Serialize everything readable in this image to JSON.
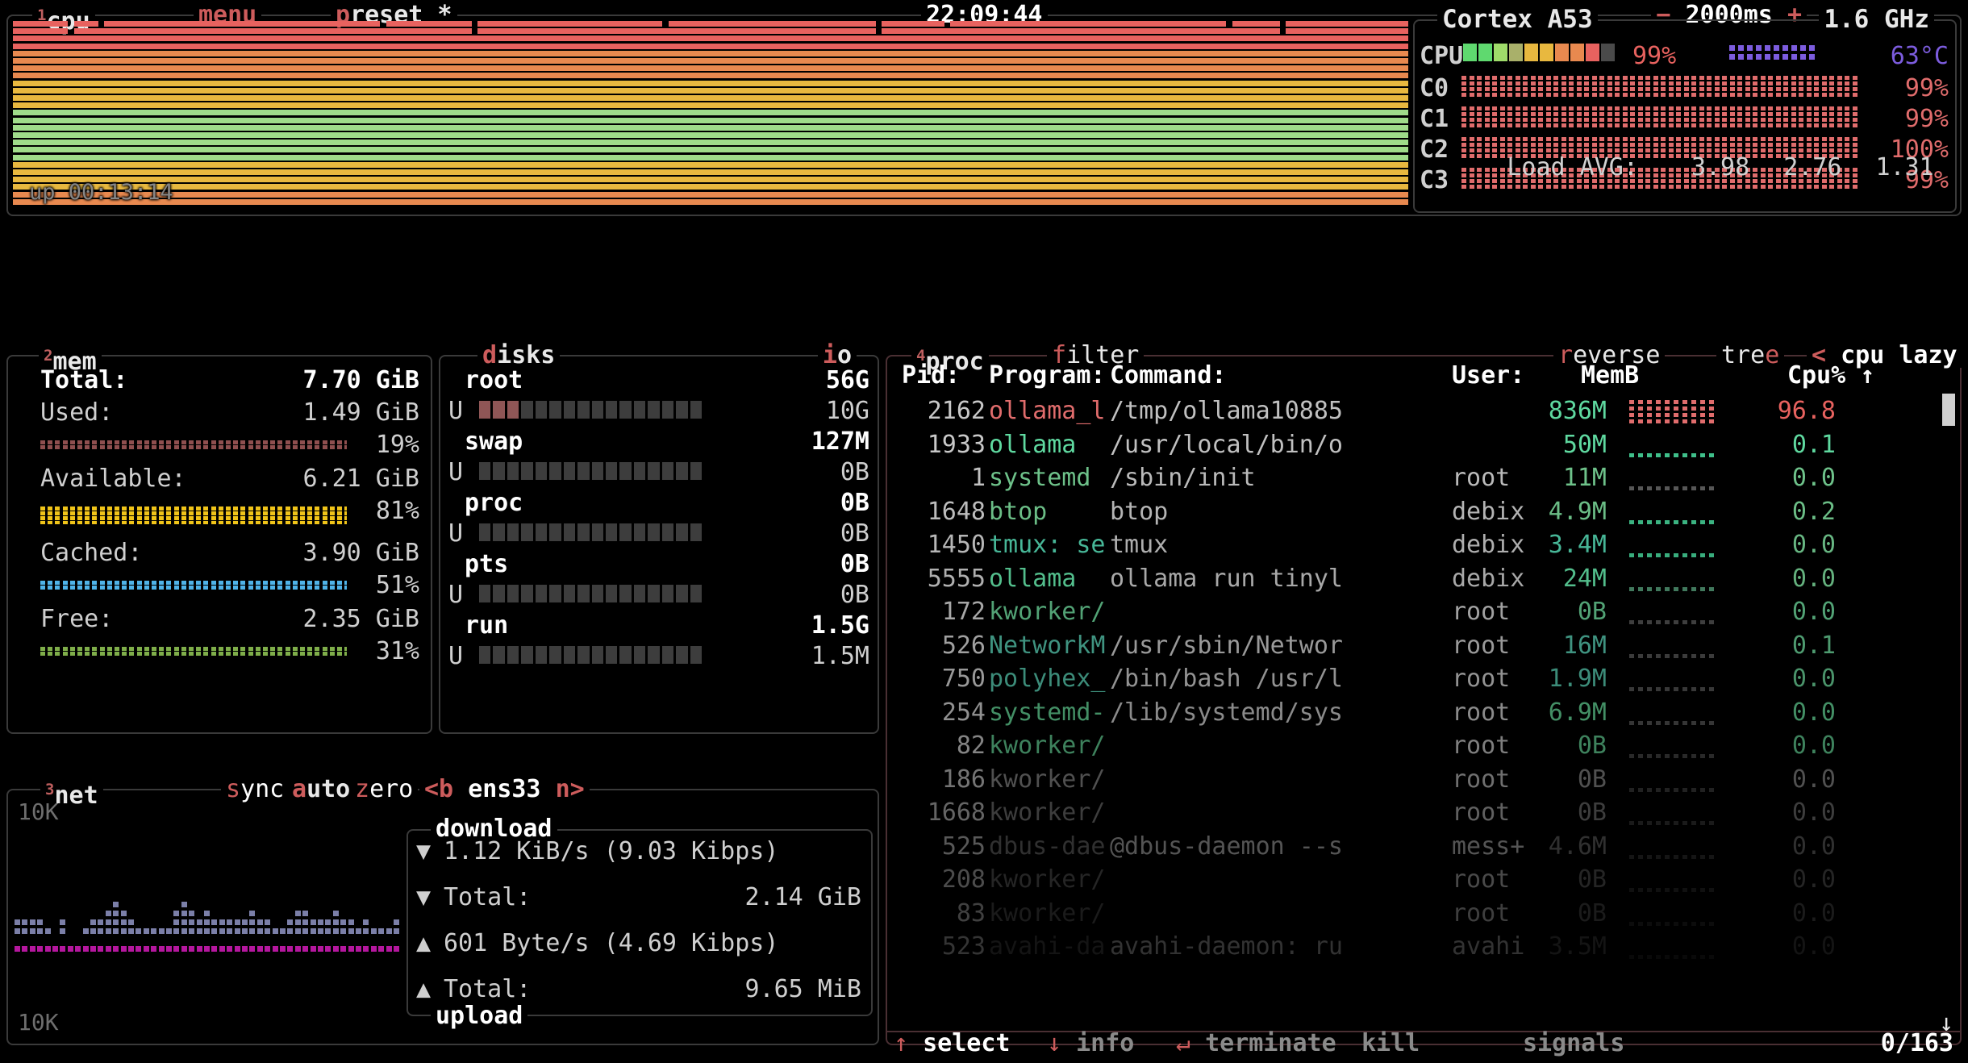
{
  "cpu": {
    "box_label": "cpu",
    "box_num": "1",
    "menu_label": "menu",
    "preset_label": "preset *",
    "clock": "22:09:44",
    "minus": "−",
    "update_ms": "2000ms",
    "plus": "+",
    "uptime": "up 00:13:14",
    "model": "Cortex A53",
    "freq": "1.6 GHz",
    "cpu_label": "CPU",
    "cpu_pct": "99%",
    "temp": "63°C",
    "cores": [
      {
        "label": "C0",
        "pct": "99%"
      },
      {
        "label": "C1",
        "pct": "99%"
      },
      {
        "label": "C2",
        "pct": "100%"
      },
      {
        "label": "C3",
        "pct": "99%"
      }
    ],
    "load_label": "Load AVG:",
    "load_1": "3.98",
    "load_5": "2.76",
    "load_15": "1.31"
  },
  "mem": {
    "box_label": "mem",
    "box_num": "2",
    "rows": [
      {
        "label": "Total:",
        "value": "7.70 GiB",
        "pct": "",
        "color": "#ffffff"
      },
      {
        "label": "Used:",
        "value": "1.49 GiB",
        "pct": "19%",
        "color": "#8f4f4f"
      },
      {
        "label": "Available:",
        "value": "6.21 GiB",
        "pct": "81%",
        "color": "#f0c419"
      },
      {
        "label": "Cached:",
        "value": "3.90 GiB",
        "pct": "51%",
        "color": "#4fb3e8"
      },
      {
        "label": "Free:",
        "value": "2.35 GiB",
        "pct": "31%",
        "color": "#7fae4a"
      }
    ]
  },
  "disks": {
    "box_label": "disks",
    "io_label": "io",
    "u_label": "U",
    "entries": [
      {
        "name": "root",
        "size": "56G",
        "used": "10G",
        "fill": 0.18
      },
      {
        "name": "swap",
        "size": "127M",
        "used": "0B",
        "fill": 0.0
      },
      {
        "name": "proc",
        "size": "0B",
        "used": "0B",
        "fill": 0.0
      },
      {
        "name": "pts",
        "size": "0B",
        "used": "0B",
        "fill": 0.0
      },
      {
        "name": "run",
        "size": "1.5G",
        "used": "1.5M",
        "fill": 0.0
      }
    ]
  },
  "net": {
    "box_label": "net",
    "box_num": "3",
    "sync_label": "sync",
    "auto_label": "auto",
    "zero_label": "zero",
    "iface_left": "<b",
    "iface": "ens33",
    "iface_right": "n>",
    "scale_top": "10K",
    "scale_bottom": "10K",
    "download_label": "download",
    "upload_label": "upload",
    "down_rate": "1.12 KiB/s (9.03 Kibps)",
    "down_total_label": "Total:",
    "down_total": "2.14 GiB",
    "up_rate": "601 Byte/s (4.69 Kibps)",
    "up_total_label": "Total:",
    "up_total": "9.65 MiB",
    "down_arrow": "▼",
    "up_arrow": "▲"
  },
  "proc": {
    "box_label": "proc",
    "box_num": "4",
    "filter_label": "filter",
    "reverse_label": "reverse",
    "tree_label": "tree",
    "sort_left": "<",
    "sort_label": "cpu lazy",
    "sort_right": ">",
    "scroll_up": "↑",
    "scroll_down": "↓",
    "headers": {
      "pid": "Pid:",
      "program": "Program:",
      "command": "Command:",
      "user": "User:",
      "mem": "MemB",
      "cpu": "Cpu% ↑"
    },
    "rows": [
      {
        "pid": "2162",
        "program": "ollama_l",
        "command": "/tmp/ollama10885",
        "user": "",
        "mem": "836M",
        "cpu": "96.8",
        "prog_color": "#e06c6c",
        "mem_color": "#5fd9a0",
        "cpu_color": "#e8625f",
        "graph_color": "#e06c6c",
        "graph": 0.97,
        "fade": 1.0,
        "selected": true
      },
      {
        "pid": "1933",
        "program": "ollama",
        "command": "/usr/local/bin/o",
        "user": "",
        "mem": "50M",
        "cpu": "0.1",
        "prog_color": "#5fd9a0",
        "mem_color": "#5fd9a0",
        "cpu_color": "#5fd9a0",
        "graph_color": "#3fbf8a",
        "graph": 0.05,
        "fade": 1.0,
        "selected": false
      },
      {
        "pid": "1",
        "program": "systemd",
        "command": "/sbin/init",
        "user": "root",
        "mem": "11M",
        "cpu": "0.0",
        "prog_color": "#72c98f",
        "mem_color": "#72c98f",
        "cpu_color": "#72c98f",
        "graph_color": "#5a5a5a",
        "graph": 0.02,
        "fade": 0.97,
        "selected": false
      },
      {
        "pid": "1648",
        "program": "btop",
        "command": "btop",
        "user": "debix",
        "mem": "4.9M",
        "cpu": "0.2",
        "prog_color": "#72c98f",
        "mem_color": "#72c98f",
        "cpu_color": "#72c98f",
        "graph_color": "#3fbf8a",
        "graph": 0.04,
        "fade": 0.94,
        "selected": false
      },
      {
        "pid": "1450",
        "program": "tmux: se",
        "command": "tmux",
        "user": "debix",
        "mem": "3.4M",
        "cpu": "0.0",
        "prog_color": "#4fc9a6",
        "mem_color": "#4fc9a6",
        "cpu_color": "#72c98f",
        "graph_color": "#3fbf8a",
        "graph": 0.03,
        "fade": 0.91,
        "selected": false
      },
      {
        "pid": "5555",
        "program": "ollama",
        "command": "ollama run tinyl",
        "user": "debix",
        "mem": "24M",
        "cpu": "0.0",
        "prog_color": "#5fd9a0",
        "mem_color": "#5fd9a0",
        "cpu_color": "#72c98f",
        "graph_color": "#4a8a6a",
        "graph": 0.03,
        "fade": 0.88,
        "selected": false
      },
      {
        "pid": "172",
        "program": "kworker/",
        "command": "",
        "user": "root",
        "mem": "0B",
        "cpu": "0.0",
        "prog_color": "#62c28c",
        "mem_color": "#62c28c",
        "cpu_color": "#62c28c",
        "graph_color": "#4a4a4a",
        "graph": 0.02,
        "fade": 0.84,
        "selected": false
      },
      {
        "pid": "526",
        "program": "NetworkM",
        "command": "/usr/sbin/Networ",
        "user": "root",
        "mem": "16M",
        "cpu": "0.1",
        "prog_color": "#4fb8a0",
        "mem_color": "#4fb8a0",
        "cpu_color": "#62c28c",
        "graph_color": "#4a4a4a",
        "graph": 0.02,
        "fade": 0.8,
        "selected": false
      },
      {
        "pid": "750",
        "program": "polyhex_",
        "command": "/bin/bash /usr/l",
        "user": "root",
        "mem": "1.9M",
        "cpu": "0.0",
        "prog_color": "#4fb8a0",
        "mem_color": "#4fb8a0",
        "cpu_color": "#62c28c",
        "graph_color": "#4a4a4a",
        "graph": 0.02,
        "fade": 0.76,
        "selected": false
      },
      {
        "pid": "254",
        "program": "systemd-",
        "command": "/lib/systemd/sys",
        "user": "root",
        "mem": "6.9M",
        "cpu": "0.0",
        "prog_color": "#5ec68d",
        "mem_color": "#5ec68d",
        "cpu_color": "#5ec68d",
        "graph_color": "#4a4a4a",
        "graph": 0.02,
        "fade": 0.72,
        "selected": false
      },
      {
        "pid": "82",
        "program": "kworker/",
        "command": "",
        "user": "root",
        "mem": "0B",
        "cpu": "0.0",
        "prog_color": "#5ec68d",
        "mem_color": "#5ec68d",
        "cpu_color": "#5ec68d",
        "graph_color": "#3f3f3f",
        "graph": 0.02,
        "fade": 0.66,
        "selected": false
      },
      {
        "pid": "186",
        "program": "kworker/",
        "command": "",
        "user": "root",
        "mem": "0B",
        "cpu": "0.0",
        "prog_color": "#8a8a8a",
        "mem_color": "#8a8a8a",
        "cpu_color": "#8a8a8a",
        "graph_color": "#3a3a3a",
        "graph": 0.02,
        "fade": 0.58,
        "selected": false
      },
      {
        "pid": "1668",
        "program": "kworker/",
        "command": "",
        "user": "root",
        "mem": "0B",
        "cpu": "0.0",
        "prog_color": "#7a7a7a",
        "mem_color": "#7a7a7a",
        "cpu_color": "#7a7a7a",
        "graph_color": "#353535",
        "graph": 0.02,
        "fade": 0.5,
        "selected": false
      },
      {
        "pid": "525",
        "program": "dbus-dae",
        "command": "@dbus-daemon --s",
        "user": "mess+",
        "mem": "4.6M",
        "cpu": "0.0",
        "prog_color": "#6f6f6f",
        "mem_color": "#6f6f6f",
        "cpu_color": "#6f6f6f",
        "graph_color": "#303030",
        "graph": 0.02,
        "fade": 0.44,
        "selected": false
      },
      {
        "pid": "208",
        "program": "kworker/",
        "command": "",
        "user": "root",
        "mem": "0B",
        "cpu": "0.0",
        "prog_color": "#616161",
        "mem_color": "#616161",
        "cpu_color": "#616161",
        "graph_color": "#2c2c2c",
        "graph": 0.02,
        "fade": 0.38,
        "selected": false
      },
      {
        "pid": "83",
        "program": "kworker/",
        "command": "",
        "user": "root",
        "mem": "0B",
        "cpu": "0.0",
        "prog_color": "#565656",
        "mem_color": "#565656",
        "cpu_color": "#565656",
        "graph_color": "#282828",
        "graph": 0.02,
        "fade": 0.32,
        "selected": false
      },
      {
        "pid": "523",
        "program": "avahi-da",
        "command": "avahi-daemon: ru",
        "user": "avahi",
        "mem": "3.5M",
        "cpu": "0.0",
        "prog_color": "#4d4d4d",
        "mem_color": "#4d4d4d",
        "cpu_color": "#4d4d4d",
        "graph_color": "#242424",
        "graph": 0.02,
        "fade": 0.26,
        "selected": false
      }
    ]
  },
  "footer": {
    "items": [
      {
        "key": "↑",
        "label": "select",
        "bright": true
      },
      {
        "key": "↓",
        "label": "info",
        "bright": false
      },
      {
        "key": "↵",
        "label": "terminate",
        "bright": false
      },
      {
        "key": "",
        "label": "kill",
        "bright": false
      },
      {
        "key": "",
        "label": "signals",
        "bright": false
      }
    ],
    "count": "0/163"
  },
  "colors": {
    "accent": "#cd5c5c",
    "frame": "#3a3a3a",
    "proc_frame": "#4a2f33",
    "graph_red": "#e8625f",
    "graph_orange": "#e8894f",
    "graph_yellow": "#e8b83f",
    "graph_green": "#9fdc8a",
    "net_down": "#7b7fa8",
    "net_up": "#b5179e",
    "temp": "#7c5cde"
  }
}
